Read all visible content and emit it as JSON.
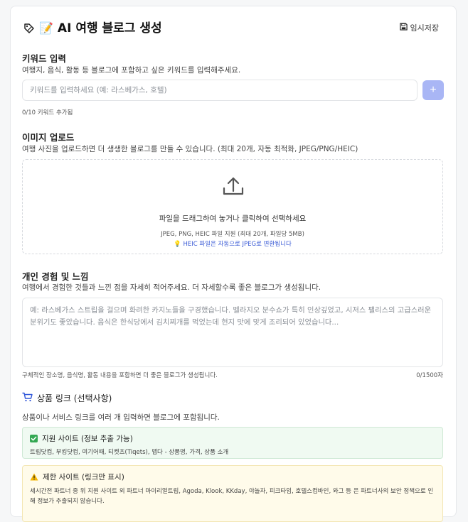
{
  "header": {
    "title": "AI 여행 블로그 생성",
    "title_emoji": "📝",
    "icons": [
      "tag-icon",
      "memo-emoji"
    ],
    "draft_label": "임시저장"
  },
  "keywords": {
    "title": "키워드 입력",
    "description": "여행지, 음식, 활동 등 블로그에 포함하고 싶은 키워드를 입력해주세요.",
    "placeholder": "키워드를 입력하세요 (예: 라스베가스, 호텔)",
    "add_label": "+",
    "count_hint": "0/10 키워드 추가됨"
  },
  "images": {
    "title": "이미지 업로드",
    "description": "여행 사진을 업로드하면 더 생생한 블로그를 만들 수 있습니다. (최대 20개, 자동 최적화, JPEG/PNG/HEIC)",
    "drop_main": "파일을 드래그하여 놓거나 클릭하여 선택하세요",
    "drop_sub": "JPEG, PNG, HEIC 파일 지원 (최대 20개, 파일당 5MB)",
    "heic_note": "💡 HEIC 파일은 자동으로 JPEG로 변환됩니다"
  },
  "experience": {
    "title": "개인 경험 및 느낌",
    "description": "여행에서 경험한 것들과 느낀 점을 자세히 적어주세요. 더 자세할수록 좋은 블로그가 생성됩니다.",
    "placeholder": "예: 라스베가스 스트립을 걸으며 화려한 카지노들을 구경했습니다. 벨라지오 분수쇼가 특히 인상깊었고, 시저스 팰리스의 고급스러운 분위기도 좋았습니다. 음식은 한식당에서 김치찌개를 먹었는데 현지 맛에 맞게 조리되어 있었습니다...",
    "hint": "구체적인 장소명, 음식명, 활동 내용을 포함하면 더 좋은 블로그가 생성됩니다.",
    "counter": "0/1500자"
  },
  "products": {
    "title": "상품 링크 (선택사항)",
    "description": "상품이나 서비스 링크를 여러 개 입력하면 블로그에 포함됩니다.",
    "supported": {
      "title": "지원 사이트 (정보 추출 가능)",
      "body": "트립닷컴, 부킹닷컴, 여기어때, 티켓츠(Tiqets), 맵다 - 상품명, 가격, 상품 소개"
    },
    "limited": {
      "title": "제한 사이트 (링크만 표시)",
      "body": "세시간전 파트너 중 위 지원 사이트 외 파트너 마이리얼트립, Agoda, Klook, KKday, 야놀자, 피크타임, 호텔스컴바인, 와그 등 은 파트너사의 보안 정책으로 인해 정보가 추출되지 않습니다."
    }
  },
  "colors": {
    "accent_button": "#a9b6f5",
    "heic_link": "#3b5bd6",
    "success_bg": "#f0faf2",
    "warning_bg": "#fffbea"
  }
}
